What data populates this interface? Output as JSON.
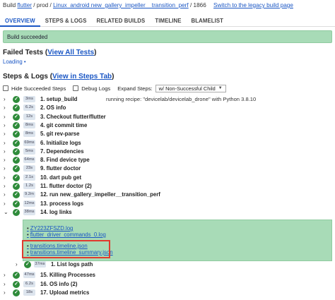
{
  "breadcrumb": {
    "prefix": "Build",
    "project": "flutter",
    "bucket": "prod",
    "builder": "Linux_android new_gallery_impeller__transition_perf",
    "build_number": "1866",
    "legacy_link": "Switch to the legacy build page"
  },
  "tabs": [
    "OVERVIEW",
    "STEPS & LOGS",
    "RELATED BUILDS",
    "TIMELINE",
    "BLAMELIST"
  ],
  "status": {
    "text": "Build succeeded",
    "color": "#a8dbb7"
  },
  "failed_tests": {
    "title": "Failed Tests",
    "link": "View All Tests",
    "loading": "Loading"
  },
  "steps_logs": {
    "title": "Steps & Logs",
    "link": "View in Steps Tab",
    "hide_succeeded": "Hide Succeeded Steps",
    "debug_logs": "Debug Logs",
    "expand_label": "Expand Steps:",
    "expand_value": "w/ Non-Successful Child"
  },
  "steps": [
    {
      "dur": "3ms",
      "name": "1. setup_build",
      "desc": "running recipe: \"devicelab/devicelab_drone\" with Python 3.8.10"
    },
    {
      "dur": "6.2s",
      "name": "2. OS info",
      "desc": ""
    },
    {
      "dur": "12s",
      "name": "3. Checkout flutter/flutter",
      "desc": ""
    },
    {
      "dur": "8ms",
      "name": "4. git commit time",
      "desc": ""
    },
    {
      "dur": "8ms",
      "name": "5. git rev-parse",
      "desc": ""
    },
    {
      "dur": "69ms",
      "name": "6. Initialize logs",
      "desc": ""
    },
    {
      "dur": "5ms",
      "name": "7. Dependencies",
      "desc": ""
    },
    {
      "dur": "64ms",
      "name": "8. Find device type",
      "desc": ""
    },
    {
      "dur": "23s",
      "name": "9. flutter doctor",
      "desc": ""
    },
    {
      "dur": "2.1s",
      "name": "10. dart pub get",
      "desc": ""
    },
    {
      "dur": "1.2s",
      "name": "11. flutter doctor (2)",
      "desc": ""
    },
    {
      "dur": "9.2m",
      "name": "12. run new_gallery_impeller__transition_perf",
      "desc": ""
    },
    {
      "dur": "12ms",
      "name": "13. process logs",
      "desc": ""
    },
    {
      "dur": "38ms",
      "name": "14. log links",
      "desc": ""
    }
  ],
  "log_links": [
    "ZY223ZFSZD.log",
    "flutter_driver_commands_0.log",
    "transitions.timeline.json",
    "transitions.timeline_summary.json"
  ],
  "substep": {
    "dur": "37ms",
    "name": "1. List logs path"
  },
  "later_steps": [
    {
      "dur": "47ms",
      "name": "15. Killing Processes"
    },
    {
      "dur": "6.2s",
      "name": "16. OS info (2)"
    },
    {
      "dur": "18s",
      "name": "17. Upload metrics"
    }
  ],
  "colors": {
    "success": "#2e8b3a",
    "link": "#1a56c4",
    "highlight": "#e03b2e"
  },
  "icons": {
    "expand": "chevron-right-icon",
    "expanded": "chevron-down-icon",
    "success": "check-circle-icon"
  }
}
